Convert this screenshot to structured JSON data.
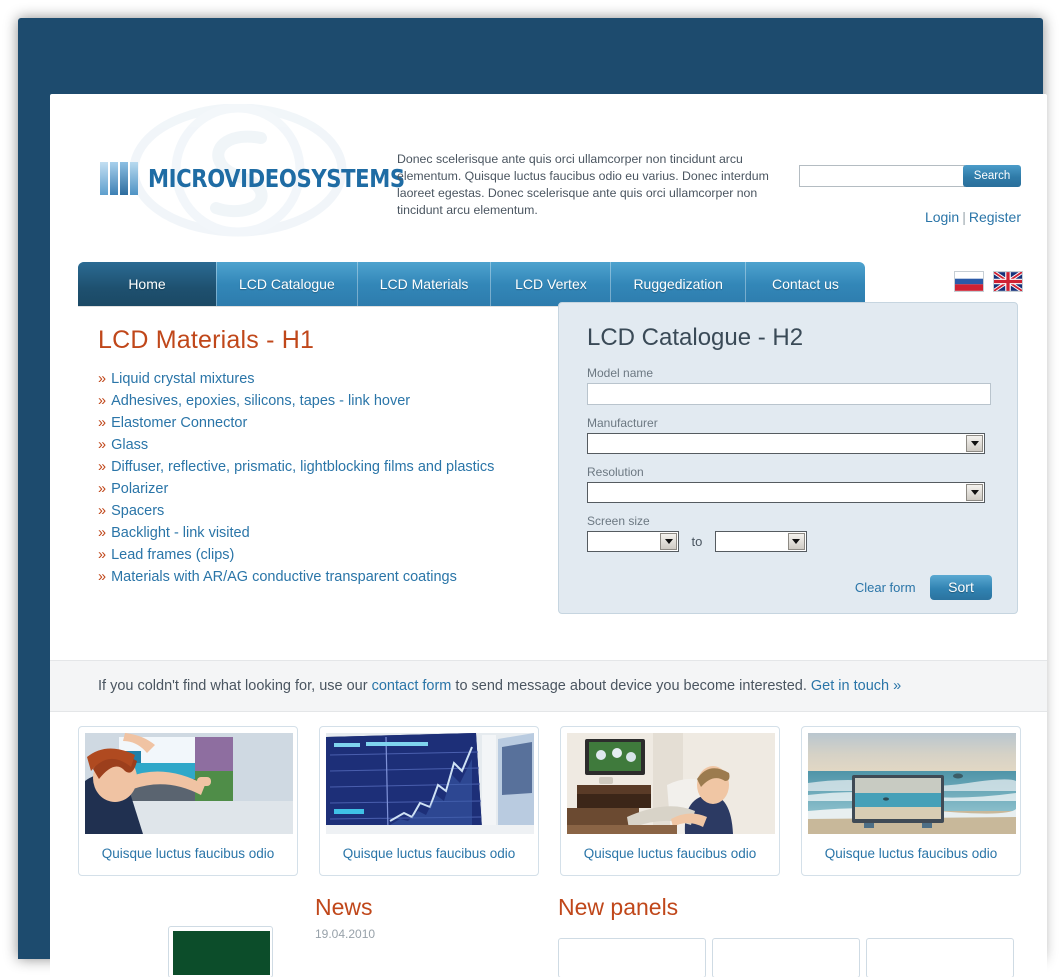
{
  "brand": {
    "logo_text": "MICROVIDEOSYSTEMS",
    "watermark_icon": "swirl-monogram-watermark"
  },
  "header": {
    "intro_paragraph": "Donec scelerisque ante quis orci ullamcorper non tincidunt arcu elementum. Quisque luctus faucibus odio eu varius. Donec interdum laoreet egestas. Donec scelerisque ante quis orci ullamcorper non tincidunt arcu elementum.",
    "search": {
      "value": "",
      "placeholder": "",
      "button_label": "Search",
      "icon": "search-icon"
    },
    "auth": {
      "login_label": "Login",
      "separator": "|",
      "register_label": "Register"
    }
  },
  "nav": {
    "items": [
      {
        "label": "Home",
        "active": true
      },
      {
        "label": "LCD Catalogue",
        "active": false
      },
      {
        "label": "LCD Materials",
        "active": false
      },
      {
        "label": "LCD Vertex",
        "active": false
      },
      {
        "label": "Ruggedization",
        "active": false
      },
      {
        "label": "Contact us",
        "active": false
      }
    ],
    "languages": [
      {
        "name": "russian-flag-icon",
        "label": "RU"
      },
      {
        "name": "uk-flag-icon",
        "label": "EN"
      }
    ]
  },
  "materials": {
    "heading": "LCD Materials - H1",
    "bullet_glyph": "»",
    "items": [
      "Liquid crystal mixtures",
      "Adhesives, epoxies, silicons, tapes - link hover",
      "Elastomer Connector",
      "Glass",
      "Diffuser, reflective, prismatic, lightblocking films and plastics",
      "Polarizer",
      "Spacers",
      "Backlight - link visited",
      "Lead frames (clips)",
      "Materials with AR/AG conductive transparent coatings"
    ]
  },
  "catalogue": {
    "heading": "LCD Catalogue - H2",
    "fields": [
      {
        "label": "Model name",
        "type": "text",
        "value": ""
      },
      {
        "label": "Manufacturer",
        "type": "select",
        "value": ""
      },
      {
        "label": "Resolution",
        "type": "select",
        "value": ""
      }
    ],
    "screen_size": {
      "label": "Screen size",
      "from_value": "",
      "to_word": "to",
      "to_value": ""
    },
    "clear_label": "Clear form",
    "sort_label": "Sort"
  },
  "contact_strip": {
    "text_before": "If you coldn't find what looking for, use our ",
    "contact_link": "contact form",
    "text_middle": " to send message about device you become interested. ",
    "cta_link": "Get in touch »"
  },
  "cards": [
    {
      "caption": "Quisque luctus faucibus odio",
      "image": "woman-touching-video-wall-photo"
    },
    {
      "caption": "Quisque luctus faucibus odio",
      "image": "blue-chart-monitors-photo"
    },
    {
      "caption": "Quisque luctus faucibus odio",
      "image": "man-on-sofa-watching-tv-photo"
    },
    {
      "caption": "Quisque luctus faucibus odio",
      "image": "tv-on-beach-photo"
    }
  ],
  "bottom": {
    "news": {
      "heading": "News",
      "date": "19.04.2010"
    },
    "new_panels": {
      "heading": "New panels"
    }
  },
  "colors": {
    "frame": "#1d4b6e",
    "accent_blue": "#2a75a8",
    "heading_orange": "#c0471a",
    "nav_blue": "#3387b8",
    "panel_bg": "#e2eaf1"
  }
}
